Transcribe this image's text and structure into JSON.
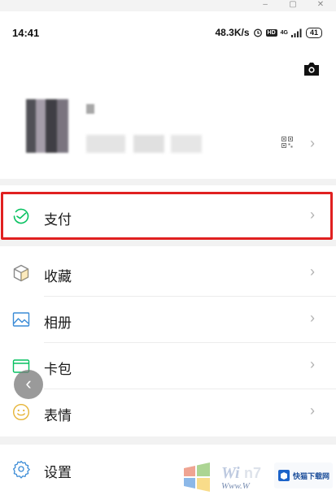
{
  "status_bar": {
    "time": "14:41",
    "speed": "48.3K/s",
    "hd": "HD",
    "network": "4G",
    "battery": "41"
  },
  "menu": {
    "pay": "支付",
    "favorites": "收藏",
    "album": "相册",
    "cards": "卡包",
    "stickers": "表情",
    "settings": "设置"
  },
  "watermark": {
    "left_text": "Www.W",
    "right_text": "快猫下载网"
  },
  "colors": {
    "accent_green": "#07c160",
    "highlight": "#e02020",
    "chevron": "#b2b2b2"
  }
}
